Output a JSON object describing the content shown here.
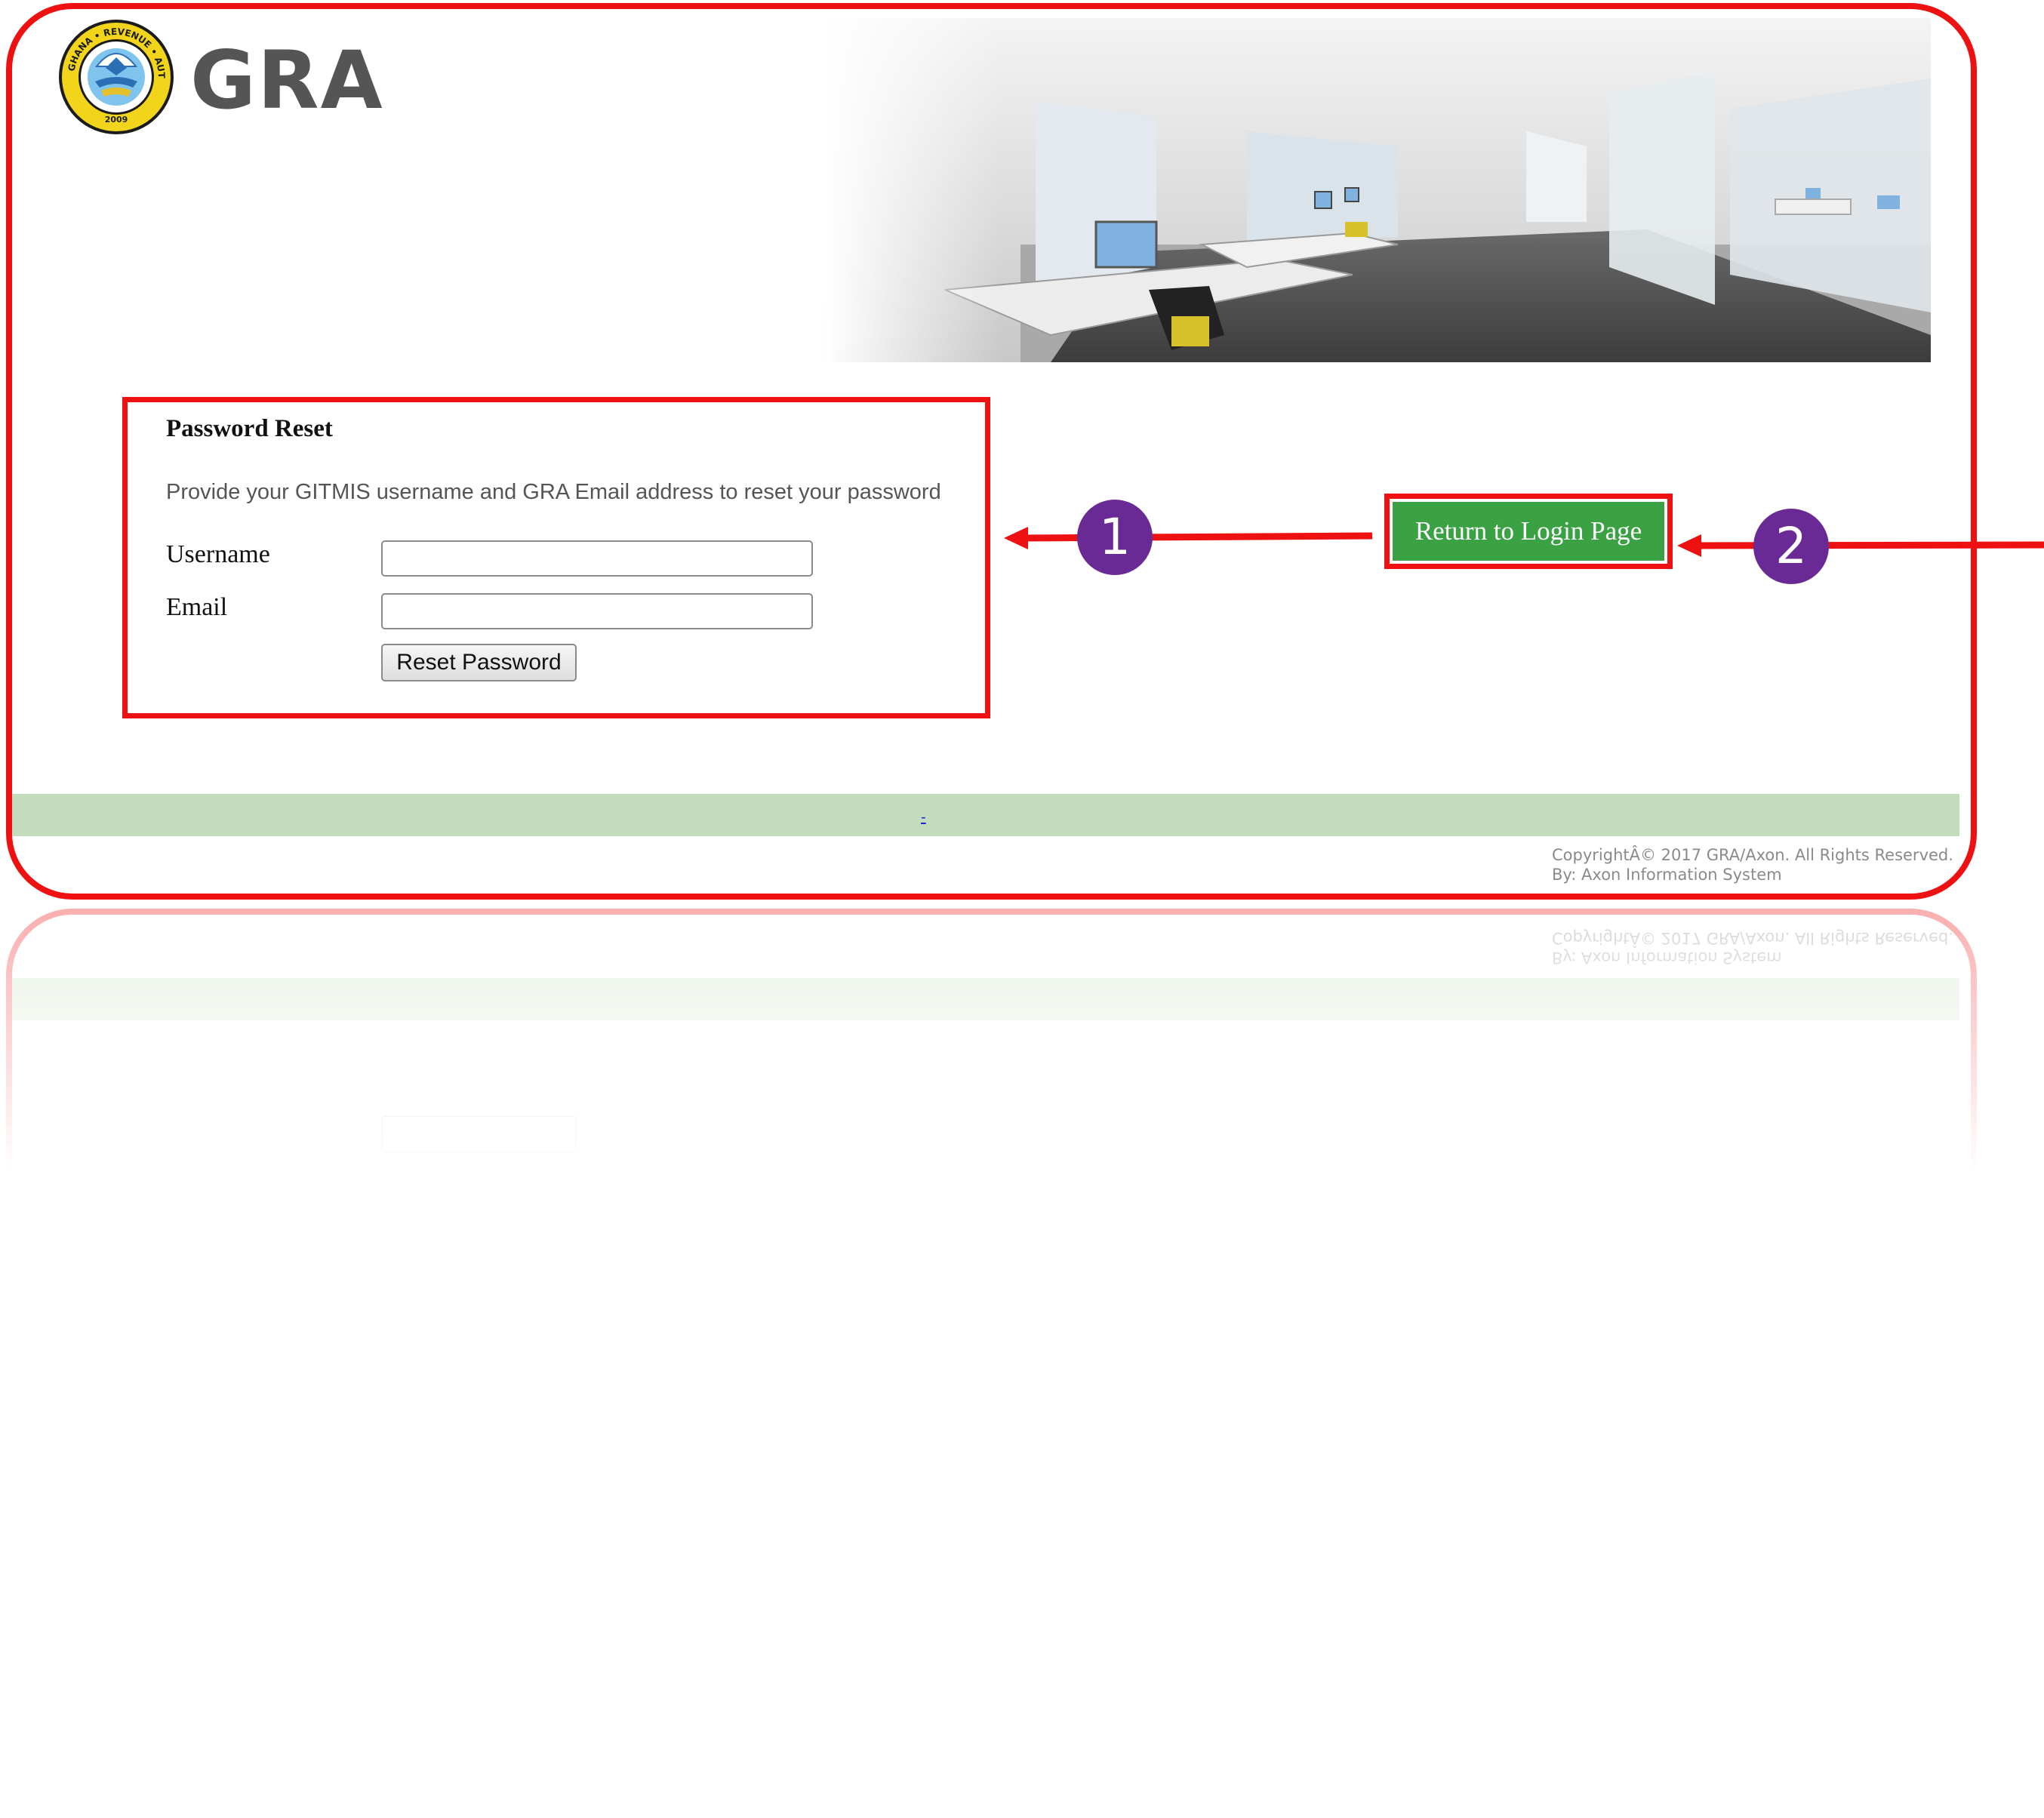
{
  "logo": {
    "text": "GRA",
    "seal_ring_text": "GHANA • REVENUE • AUTHORITY",
    "seal_year": "2009"
  },
  "banner": {
    "image": "office-interior-photo"
  },
  "reset_form": {
    "title": "Password Reset",
    "description": "Provide your GITMIS username and GRA Email address to reset your password",
    "username_label": "Username",
    "username_value": "",
    "email_label": "Email",
    "email_value": "",
    "submit_label": "Reset Password"
  },
  "return_button": {
    "label": "Return to Login Page"
  },
  "callouts": {
    "first": "1",
    "second": "2"
  },
  "footer": {
    "link_text": "-",
    "copyright": "CopyrightÂ© 2017 GRA/Axon. All Rights Reserved.",
    "credit": "By: Axon Information System"
  },
  "colors": {
    "annotation_red": "#ee1111",
    "callout_purple": "#6a2a96",
    "button_green": "#3aa243",
    "footer_band": "#c3ddbc",
    "logo_gold": "#f2d51a"
  },
  "icons": {
    "seal": "gra-seal-icon",
    "arrow": "arrow-left-icon"
  }
}
